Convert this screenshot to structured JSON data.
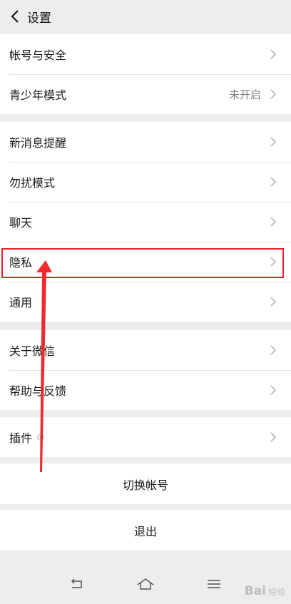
{
  "header": {
    "title": "设置"
  },
  "groups": [
    {
      "items": [
        {
          "label": "帐号与安全",
          "value": ""
        },
        {
          "label": "青少年模式",
          "value": "未开启"
        }
      ]
    },
    {
      "items": [
        {
          "label": "新消息提醒",
          "value": ""
        },
        {
          "label": "勿扰模式",
          "value": ""
        },
        {
          "label": "聊天",
          "value": ""
        },
        {
          "label": "隐私",
          "value": ""
        },
        {
          "label": "通用",
          "value": ""
        }
      ]
    },
    {
      "items": [
        {
          "label": "关于微信",
          "value": ""
        },
        {
          "label": "帮助与反馈",
          "value": ""
        }
      ]
    },
    {
      "items": [
        {
          "label": "插件",
          "value": ""
        }
      ]
    }
  ],
  "actions": {
    "switch_account": "切换帐号",
    "logout": "退出"
  },
  "watermark": {
    "logo": "Bai",
    "text": "经验"
  },
  "colors": {
    "highlight": "#e8202a",
    "background": "#ededed"
  }
}
